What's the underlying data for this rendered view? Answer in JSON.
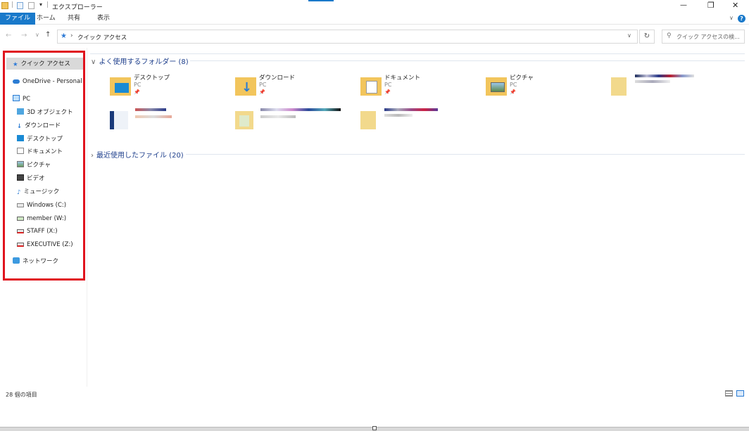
{
  "window": {
    "title": "エクスプローラー",
    "minimize": "—",
    "maximize": "❐",
    "close": "✕"
  },
  "ribbon": {
    "tabs": [
      "ファイル",
      "ホーム",
      "共有",
      "表示"
    ],
    "help": "?"
  },
  "address": {
    "path_label": "クイック アクセス",
    "search_placeholder": "クイック アクセスの検..."
  },
  "sidebar": {
    "items": [
      {
        "label": "クイック アクセス",
        "icon": "star-icon"
      },
      {
        "label": "OneDrive - Personal",
        "icon": "cloud-icon"
      },
      {
        "label": "PC",
        "icon": "pc-icon"
      },
      {
        "label": "3D オブジェクト",
        "icon": "cube-icon"
      },
      {
        "label": "ダウンロード",
        "icon": "download-icon"
      },
      {
        "label": "デスクトップ",
        "icon": "desktop-icon"
      },
      {
        "label": "ドキュメント",
        "icon": "document-icon"
      },
      {
        "label": "ピクチャ",
        "icon": "picture-icon"
      },
      {
        "label": "ビデオ",
        "icon": "video-icon"
      },
      {
        "label": "ミュージック",
        "icon": "music-icon"
      },
      {
        "label": "Windows (C:)",
        "icon": "drive-icon"
      },
      {
        "label": "member (W:)",
        "icon": "network-drive-icon"
      },
      {
        "label": "STAFF (X:)",
        "icon": "disconnected-drive-icon"
      },
      {
        "label": "EXECUTIVE (Z:)",
        "icon": "disconnected-drive-icon"
      },
      {
        "label": "ネットワーク",
        "icon": "network-icon"
      }
    ]
  },
  "main": {
    "frequent_header": "よく使用するフォルダー (8)",
    "recent_header": "最近使用したファイル (20)",
    "folders": [
      {
        "name": "デスクトップ",
        "sub": "PC"
      },
      {
        "name": "ダウンロード",
        "sub": "PC"
      },
      {
        "name": "ドキュメント",
        "sub": "PC"
      },
      {
        "name": "ピクチャ",
        "sub": "PC"
      }
    ]
  },
  "status": {
    "count": "28 個の項目"
  },
  "colors": {
    "accent": "#1979ca",
    "highlight": "#e0141e",
    "folder": "#f2c55c"
  }
}
